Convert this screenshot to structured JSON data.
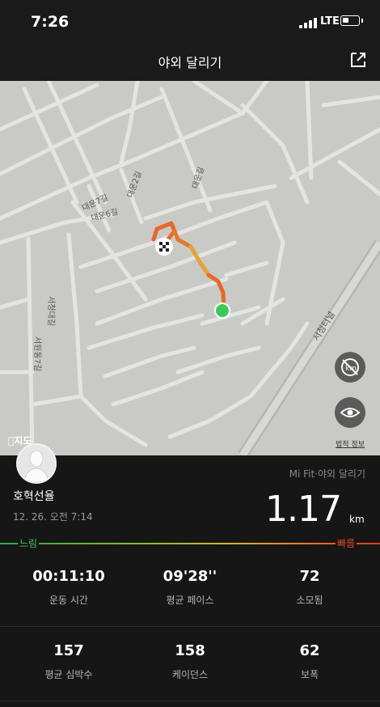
{
  "status": {
    "time": "7:26",
    "network": "LTE"
  },
  "header": {
    "title": "야외 달리기",
    "share_icon": "share-icon"
  },
  "map": {
    "road_labels": {
      "a": "대운2길",
      "b": "대운7길",
      "c": "대운6길",
      "d": "대운길",
      "e": "서청대길",
      "f": "서원동7길",
      "g": "서청터널"
    },
    "apple_maps": "지도",
    "legal": "법적 정보",
    "buttons": {
      "unit": "km-toggle-icon",
      "view": "eye-icon"
    }
  },
  "workout": {
    "source": "Mi Fit·야외 달리기",
    "user": "호혁선율",
    "datetime": "12. 26. 오전 7:14",
    "distance": "1.17",
    "unit": "km"
  },
  "pace_scale": {
    "slow": "느림",
    "fast": "빠름"
  },
  "stats": [
    {
      "value": "00:11:10",
      "label": "운동 시간"
    },
    {
      "value": "09'28''",
      "label": "평균 페이스"
    },
    {
      "value": "72",
      "label": "소모됨"
    },
    {
      "value": "157",
      "label": "평균 심박수"
    },
    {
      "value": "158",
      "label": "케이던스"
    },
    {
      "value": "62",
      "label": "보폭"
    }
  ],
  "colors": {
    "route_slow": "#e8a23a",
    "route_fast": "#e0391e",
    "start": "#3cc85a"
  }
}
